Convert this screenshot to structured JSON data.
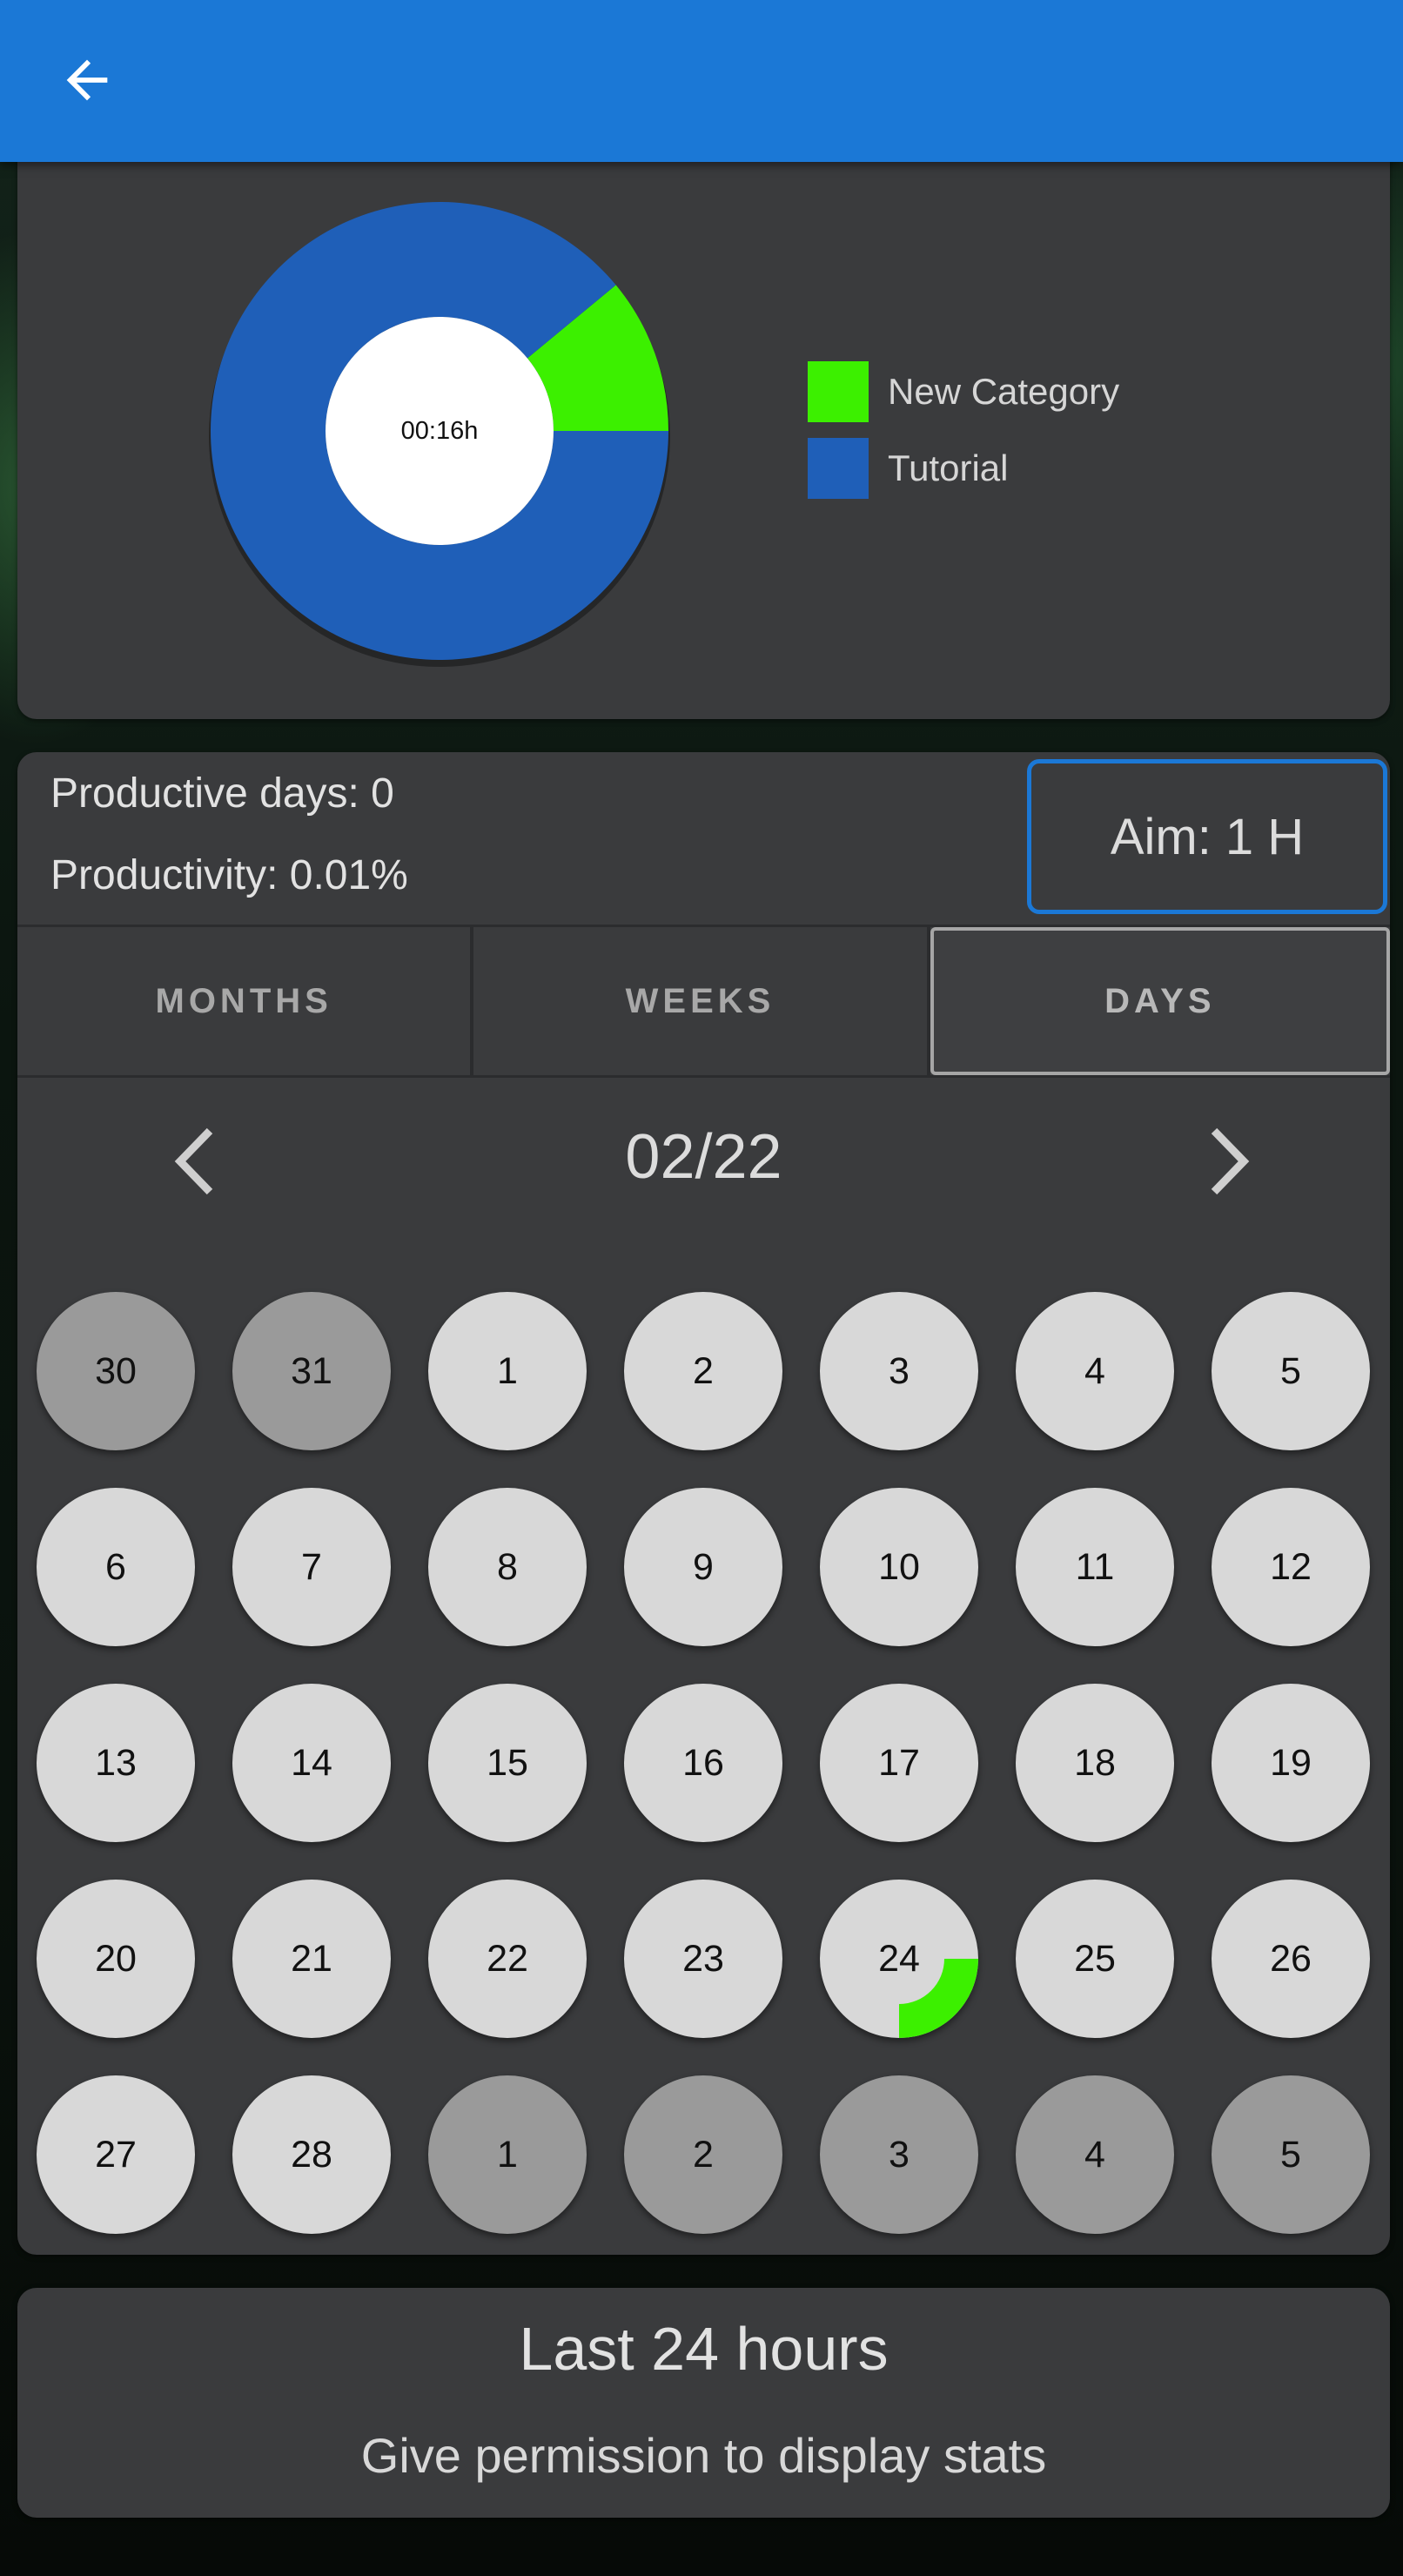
{
  "appbar": {
    "back_icon": "arrow-left-icon",
    "color": "#1b78d6"
  },
  "chart_data": {
    "type": "pie",
    "center_label": "00:16h",
    "series": [
      {
        "name": "New Category",
        "value": 0.11,
        "color": "#3cf000"
      },
      {
        "name": "Tutorial",
        "value": 0.89,
        "color": "#1f5fb8"
      }
    ]
  },
  "stats": {
    "productive_days": "Productive days: 0",
    "productivity": "Productivity: 0.01%",
    "aim_label": "Aim: 1 H"
  },
  "tabs": [
    {
      "label": "MONTHS",
      "selected": false
    },
    {
      "label": "WEEKS",
      "selected": false
    },
    {
      "label": "DAYS",
      "selected": true
    }
  ],
  "calendar": {
    "title": "02/22",
    "prev_icon": "chevron-left-icon",
    "next_icon": "chevron-right-icon",
    "progress_color": "#3cf000",
    "days": [
      {
        "label": "30",
        "current_month": false,
        "progress": 0
      },
      {
        "label": "31",
        "current_month": false,
        "progress": 0
      },
      {
        "label": "1",
        "current_month": true,
        "progress": 0
      },
      {
        "label": "2",
        "current_month": true,
        "progress": 0
      },
      {
        "label": "3",
        "current_month": true,
        "progress": 0
      },
      {
        "label": "4",
        "current_month": true,
        "progress": 0
      },
      {
        "label": "5",
        "current_month": true,
        "progress": 0
      },
      {
        "label": "6",
        "current_month": true,
        "progress": 0
      },
      {
        "label": "7",
        "current_month": true,
        "progress": 0
      },
      {
        "label": "8",
        "current_month": true,
        "progress": 0
      },
      {
        "label": "9",
        "current_month": true,
        "progress": 0
      },
      {
        "label": "10",
        "current_month": true,
        "progress": 0
      },
      {
        "label": "11",
        "current_month": true,
        "progress": 0
      },
      {
        "label": "12",
        "current_month": true,
        "progress": 0
      },
      {
        "label": "13",
        "current_month": true,
        "progress": 0
      },
      {
        "label": "14",
        "current_month": true,
        "progress": 0
      },
      {
        "label": "15",
        "current_month": true,
        "progress": 0
      },
      {
        "label": "16",
        "current_month": true,
        "progress": 0
      },
      {
        "label": "17",
        "current_month": true,
        "progress": 0
      },
      {
        "label": "18",
        "current_month": true,
        "progress": 0
      },
      {
        "label": "19",
        "current_month": true,
        "progress": 0
      },
      {
        "label": "20",
        "current_month": true,
        "progress": 0
      },
      {
        "label": "21",
        "current_month": true,
        "progress": 0
      },
      {
        "label": "22",
        "current_month": true,
        "progress": 0
      },
      {
        "label": "23",
        "current_month": true,
        "progress": 0
      },
      {
        "label": "24",
        "current_month": true,
        "progress": 0.25
      },
      {
        "label": "25",
        "current_month": true,
        "progress": 0
      },
      {
        "label": "26",
        "current_month": true,
        "progress": 0
      },
      {
        "label": "27",
        "current_month": true,
        "progress": 0
      },
      {
        "label": "28",
        "current_month": true,
        "progress": 0
      },
      {
        "label": "1",
        "current_month": false,
        "progress": 0
      },
      {
        "label": "2",
        "current_month": false,
        "progress": 0
      },
      {
        "label": "3",
        "current_month": false,
        "progress": 0
      },
      {
        "label": "4",
        "current_month": false,
        "progress": 0
      },
      {
        "label": "5",
        "current_month": false,
        "progress": 0
      }
    ]
  },
  "last24": {
    "title": "Last 24 hours",
    "subtitle": "Give permission to display stats"
  }
}
